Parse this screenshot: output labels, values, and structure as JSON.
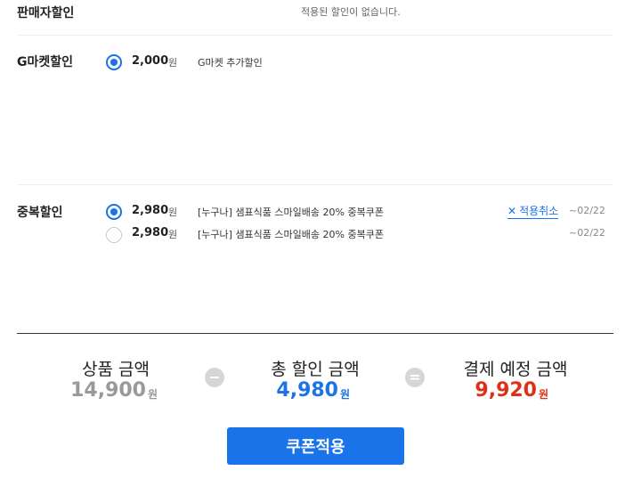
{
  "seller_discount": {
    "title": "판매자할인",
    "empty_text": "적용된 할인이 없습니다."
  },
  "gmarket_discount": {
    "title": "G마켓할인",
    "option": {
      "amount": "2,000",
      "won": "원",
      "desc": "G마켓 추가할인",
      "checked": true
    }
  },
  "stacked_discount": {
    "title": "중복할인",
    "options": [
      {
        "amount": "2,980",
        "won": "원",
        "desc": "[누구나] 샘표식품 스마일배송 20% 중복쿠폰",
        "date": "~02/22",
        "checked": true,
        "cancel_label": "적용취소"
      },
      {
        "amount": "2,980",
        "won": "원",
        "desc": "[누구나] 샘표식품 스마일배송 20% 중복쿠폰",
        "date": "~02/22",
        "checked": false
      }
    ]
  },
  "summary": {
    "product": {
      "label": "상품 금액",
      "value": "14,900",
      "won": "원",
      "color": "#999999"
    },
    "minus_symbol": "−",
    "discount": {
      "label": "총 할인 금액",
      "value": "4,980",
      "won": "원",
      "color": "#1a73e8"
    },
    "equals_symbol": "=",
    "payment": {
      "label": "결제 예정 금액",
      "value": "9,920",
      "won": "원",
      "color": "#e02f17"
    }
  },
  "apply_button": {
    "label": "쿠폰적용"
  },
  "colors": {
    "accent": "#1a73e8",
    "payment_red": "#e02f17"
  },
  "icons": {
    "cancel": "close-icon",
    "minus": "minus-icon",
    "equals": "equals-icon"
  }
}
